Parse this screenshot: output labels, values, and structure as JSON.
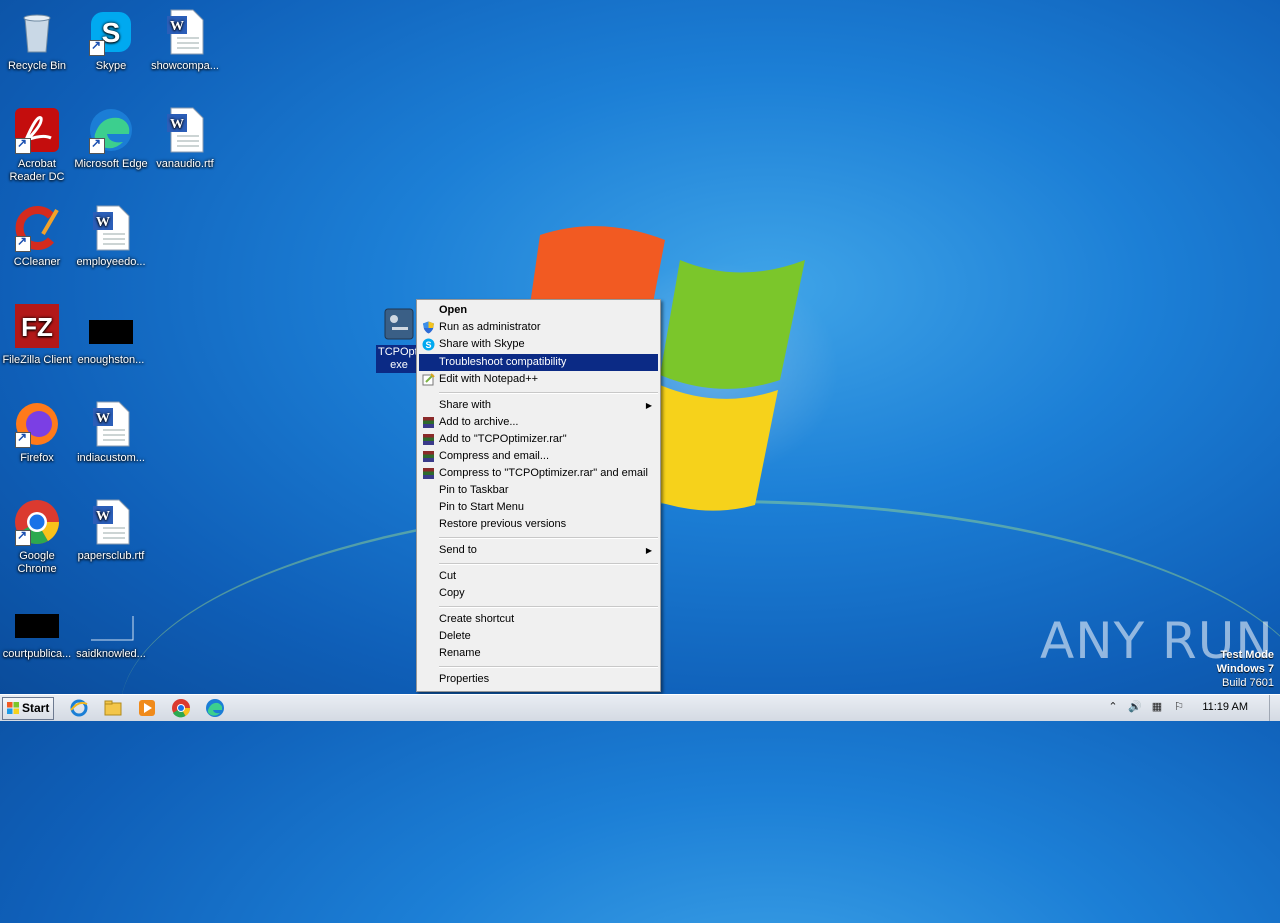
{
  "desktop": {
    "icons": [
      {
        "label": "Recycle Bin"
      },
      {
        "label": "Skype"
      },
      {
        "label": "showcompa..."
      },
      {
        "label": "Acrobat Reader DC"
      },
      {
        "label": "Microsoft Edge"
      },
      {
        "label": "vanaudio.rtf"
      },
      {
        "label": "CCleaner"
      },
      {
        "label": "employeedo..."
      },
      {
        "label": "FileZilla Client"
      },
      {
        "label": "enoughston..."
      },
      {
        "label": "Firefox"
      },
      {
        "label": "indiacustom..."
      },
      {
        "label": "Google Chrome"
      },
      {
        "label": "papersclub.rtf"
      },
      {
        "label": "courtpublica..."
      },
      {
        "label": "saidknowled..."
      }
    ],
    "selected_file": {
      "label_line1": "TCPOpti",
      "label_line2": "exe"
    }
  },
  "context_menu": {
    "items": [
      {
        "label": "Open"
      },
      {
        "label": "Run as administrator"
      },
      {
        "label": "Share with Skype"
      },
      {
        "label": "Troubleshoot compatibility"
      },
      {
        "label": "Edit with Notepad++"
      },
      {
        "label": "Share with"
      },
      {
        "label": "Add to archive..."
      },
      {
        "label": "Add to \"TCPOptimizer.rar\""
      },
      {
        "label": "Compress and email..."
      },
      {
        "label": "Compress to \"TCPOptimizer.rar\" and email"
      },
      {
        "label": "Pin to Taskbar"
      },
      {
        "label": "Pin to Start Menu"
      },
      {
        "label": "Restore previous versions"
      },
      {
        "label": "Send to"
      },
      {
        "label": "Cut"
      },
      {
        "label": "Copy"
      },
      {
        "label": "Create shortcut"
      },
      {
        "label": "Delete"
      },
      {
        "label": "Rename"
      },
      {
        "label": "Properties"
      }
    ],
    "highlighted": "Troubleshoot compatibility"
  },
  "taskbar": {
    "start_label": "Start",
    "clock": "11:19 AM"
  },
  "watermark": "ANY RUN",
  "test_mode": {
    "line1": "Test Mode",
    "line2": "Windows 7",
    "line3": "Build 7601"
  },
  "colors": {
    "highlight": "#0b2a85",
    "menu_bg": "#f0f0f0"
  }
}
